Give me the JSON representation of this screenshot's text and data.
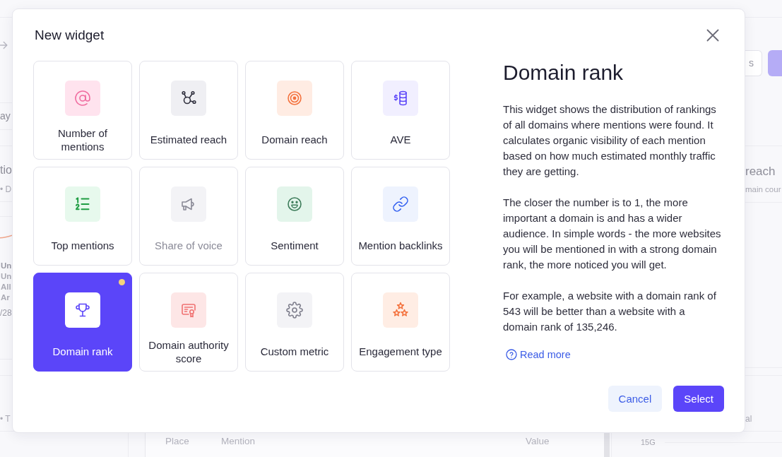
{
  "background": {
    "toolbar_text": "ay",
    "left_panel": {
      "title": "tio",
      "subtitle": "• D",
      "tooltip_title": "Un",
      "tooltip_lines": [
        "Un",
        "All",
        "Ar"
      ],
      "date": "/28",
      "legend": "• T"
    },
    "right_panel": {
      "buttons": [
        {
          "label": "s",
          "kind": "outline"
        },
        {
          "kind": "primary"
        }
      ],
      "title": "reach",
      "subtitle": "main cour",
      "legend": "al"
    },
    "table": {
      "columns": [
        "Place",
        "Mention",
        "Value"
      ]
    },
    "chart": {
      "axis_label": "15G"
    }
  },
  "modal": {
    "title": "New widget",
    "tiles": [
      {
        "label": "Number of mentions",
        "selected": false,
        "disabled": false,
        "notification_dot": false
      },
      {
        "label": "Estimated reach",
        "selected": false,
        "disabled": false,
        "notification_dot": false
      },
      {
        "label": "Domain reach",
        "selected": false,
        "disabled": false,
        "notification_dot": false
      },
      {
        "label": "AVE",
        "selected": false,
        "disabled": false,
        "notification_dot": false
      },
      {
        "label": "Top mentions",
        "selected": false,
        "disabled": false,
        "notification_dot": false
      },
      {
        "label": "Share of voice",
        "selected": false,
        "disabled": true,
        "notification_dot": false
      },
      {
        "label": "Sentiment",
        "selected": false,
        "disabled": false,
        "notification_dot": false
      },
      {
        "label": "Mention backlinks",
        "selected": false,
        "disabled": false,
        "notification_dot": false
      },
      {
        "label": "Domain rank",
        "selected": true,
        "disabled": false,
        "notification_dot": true
      },
      {
        "label": "Domain authority score",
        "selected": false,
        "disabled": false,
        "notification_dot": false
      },
      {
        "label": "Custom metric",
        "selected": false,
        "disabled": false,
        "notification_dot": false
      },
      {
        "label": "Engagement type",
        "selected": false,
        "disabled": false,
        "notification_dot": false
      }
    ],
    "details": {
      "title": "Domain rank",
      "paragraphs": [
        "This widget shows the distribution of rankings of all domains where mentions were found. It calculates organic visibility of each mention based on how much estimated monthly traffic they are getting.",
        "The closer the number is to 1, the more important a domain is and has a wider audience. In simple words - the more websites you will be mentioned in with a strong domain rank, the more noticed you will get.",
        "For example, a website with a domain rank of 543 will be better than a website with a domain rank of 135,246."
      ],
      "link": "Read more"
    },
    "buttons": [
      {
        "label": "Cancel",
        "kind": "cancel"
      },
      {
        "label": "Select",
        "kind": "confirm"
      }
    ]
  }
}
